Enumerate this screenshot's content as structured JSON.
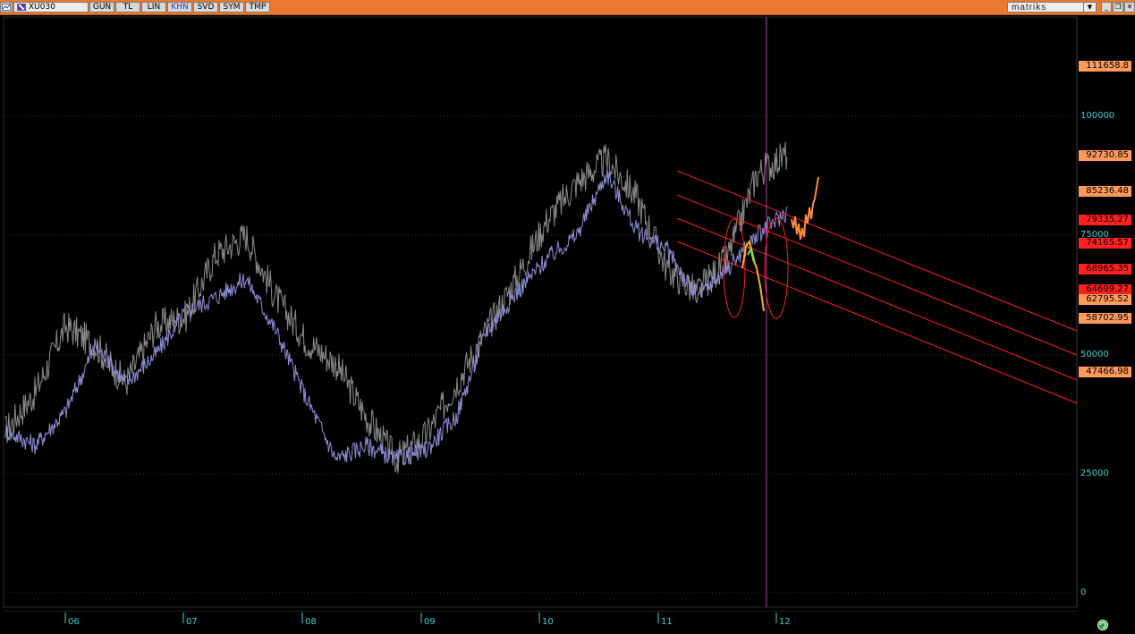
{
  "toolbar": {
    "symbol": "XU030",
    "buttons": [
      "GUN",
      "TL",
      "LIN",
      "KHN",
      "SVD",
      "SYM",
      "TMP"
    ],
    "active_button": "KHN",
    "brand": "matriks",
    "window_controls": [
      "minimize",
      "restore",
      "close"
    ]
  },
  "colors": {
    "toolbar": "#e8792e",
    "axis_text": "#3fd0d0",
    "series_main": "#8a8a8a",
    "series_comp": "#8e8ed8",
    "channel": "#ff2020",
    "cursor": "#b040b0"
  },
  "y_ticks": [
    "100000",
    "75000",
    "50000",
    "25000",
    "0"
  ],
  "price_labels": [
    {
      "text": "111658.8",
      "color": "#ff9a5a"
    },
    {
      "text": "92730.85",
      "color": "#ff9a5a"
    },
    {
      "text": "85236.48",
      "color": "#ff9a5a"
    },
    {
      "text": "79335.27",
      "color": "#ff2020"
    },
    {
      "text": "74165.57",
      "color": "#ff2020"
    },
    {
      "text": "68965.35",
      "color": "#ff2020"
    },
    {
      "text": "64699.27",
      "color": "#ff2020"
    },
    {
      "text": "62795.52",
      "color": "#ff9a5a"
    },
    {
      "text": "58702.95",
      "color": "#ff9a5a"
    },
    {
      "text": "47466.98",
      "color": "#ff9a5a"
    }
  ],
  "x_ticks": [
    "06",
    "07",
    "08",
    "09",
    "10",
    "11",
    "12"
  ],
  "chart_data": {
    "type": "line",
    "ylim": [
      0,
      120000
    ],
    "series": [
      {
        "x": [
          "06",
          "06",
          "06",
          "06",
          "07",
          "07",
          "07",
          "07",
          "08",
          "08",
          "08",
          "08",
          "09",
          "09",
          "09",
          "09",
          "10",
          "10",
          "10",
          "10",
          "11",
          "11",
          "11",
          "11",
          "12",
          "12",
          "12"
        ],
        "values": [
          34000,
          42000,
          56000,
          52000,
          44000,
          56000,
          58000,
          71000,
          75000,
          62000,
          53000,
          48000,
          37000,
          28000,
          33000,
          44000,
          55000,
          66000,
          78000,
          86000,
          91000,
          83000,
          68000,
          63000,
          70000,
          88000,
          92000
        ]
      },
      {
        "x": [
          "06",
          "06",
          "06",
          "06",
          "07",
          "07",
          "07",
          "07",
          "08",
          "08",
          "08",
          "08",
          "09",
          "09",
          "09",
          "09",
          "10",
          "10",
          "10",
          "10",
          "11",
          "11",
          "11",
          "11",
          "12",
          "12",
          "12"
        ],
        "values": [
          34000,
          31000,
          38000,
          52000,
          44000,
          50000,
          59000,
          62000,
          66000,
          55000,
          41000,
          28000,
          31000,
          28000,
          30000,
          37000,
          55000,
          63000,
          70000,
          75000,
          88000,
          76000,
          72000,
          62000,
          68000,
          75000,
          80000
        ]
      }
    ]
  }
}
